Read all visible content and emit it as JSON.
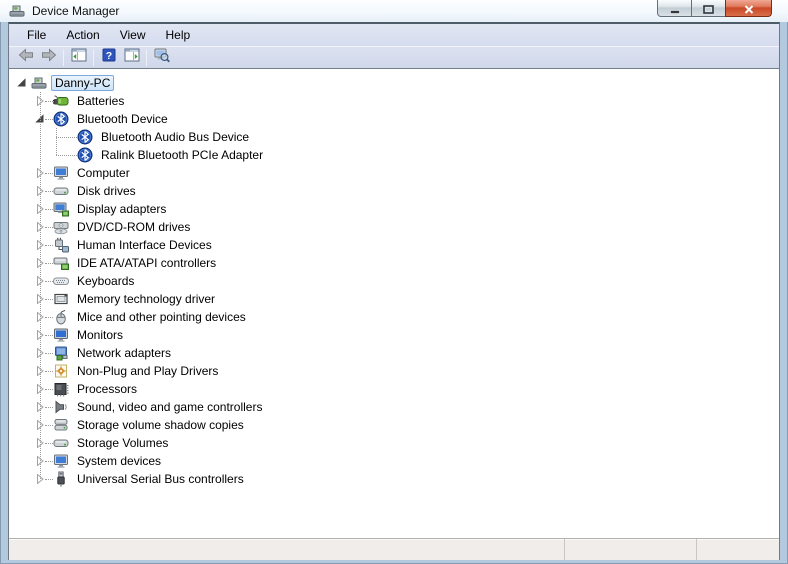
{
  "window": {
    "title": "Device Manager",
    "icon": "device-manager-icon",
    "controls": [
      {
        "name": "minimize"
      },
      {
        "name": "maximize"
      },
      {
        "name": "close"
      }
    ]
  },
  "menubar": {
    "items": [
      {
        "label": "File"
      },
      {
        "label": "Action"
      },
      {
        "label": "View"
      },
      {
        "label": "Help"
      }
    ]
  },
  "toolbar": {
    "buttons": [
      {
        "name": "back",
        "icon": "back-arrow-icon",
        "disabled": true
      },
      {
        "name": "forward",
        "icon": "forward-arrow-icon",
        "disabled": true
      },
      {
        "separator": true
      },
      {
        "name": "show-console-tree",
        "icon": "console-tree-icon"
      },
      {
        "separator": true
      },
      {
        "name": "help",
        "icon": "help-icon"
      },
      {
        "name": "show-action-pane",
        "icon": "action-pane-icon"
      },
      {
        "separator": true
      },
      {
        "name": "scan-for-hardware-changes",
        "icon": "scan-icon"
      }
    ]
  },
  "tree": {
    "items": [
      {
        "label": "Danny-PC",
        "level": 0,
        "expander": "expanded",
        "icon": "computer-root-icon",
        "selected": true
      },
      {
        "label": "Batteries",
        "level": 1,
        "expander": "collapsed",
        "icon": "battery-icon",
        "selected": false
      },
      {
        "label": "Bluetooth Device",
        "level": 1,
        "expander": "expanded",
        "icon": "bluetooth-icon",
        "selected": false
      },
      {
        "label": "Bluetooth Audio Bus Device",
        "level": 2,
        "expander": "none",
        "icon": "bluetooth-icon",
        "selected": false
      },
      {
        "label": "Ralink Bluetooth PCIe Adapter",
        "level": 2,
        "expander": "none",
        "icon": "bluetooth-icon",
        "selected": false
      },
      {
        "label": "Computer",
        "level": 1,
        "expander": "collapsed",
        "icon": "computer-icon",
        "selected": false
      },
      {
        "label": "Disk drives",
        "level": 1,
        "expander": "collapsed",
        "icon": "disk-drive-icon",
        "selected": false
      },
      {
        "label": "Display adapters",
        "level": 1,
        "expander": "collapsed",
        "icon": "display-adapter-icon",
        "selected": false
      },
      {
        "label": "DVD/CD-ROM drives",
        "level": 1,
        "expander": "collapsed",
        "icon": "dvd-drive-icon",
        "selected": false
      },
      {
        "label": "Human Interface Devices",
        "level": 1,
        "expander": "collapsed",
        "icon": "hid-icon",
        "selected": false
      },
      {
        "label": "IDE ATA/ATAPI controllers",
        "level": 1,
        "expander": "collapsed",
        "icon": "ide-controller-icon",
        "selected": false
      },
      {
        "label": "Keyboards",
        "level": 1,
        "expander": "collapsed",
        "icon": "keyboard-icon",
        "selected": false
      },
      {
        "label": "Memory technology driver",
        "level": 1,
        "expander": "collapsed",
        "icon": "memory-card-icon",
        "selected": false
      },
      {
        "label": "Mice and other pointing devices",
        "level": 1,
        "expander": "collapsed",
        "icon": "mouse-icon",
        "selected": false
      },
      {
        "label": "Monitors",
        "level": 1,
        "expander": "collapsed",
        "icon": "monitor-icon",
        "selected": false
      },
      {
        "label": "Network adapters",
        "level": 1,
        "expander": "collapsed",
        "icon": "network-adapter-icon",
        "selected": false
      },
      {
        "label": "Non-Plug and Play Drivers",
        "level": 1,
        "expander": "collapsed",
        "icon": "non-pnp-driver-icon",
        "selected": false
      },
      {
        "label": "Processors",
        "level": 1,
        "expander": "collapsed",
        "icon": "processor-icon",
        "selected": false
      },
      {
        "label": "Sound, video and game controllers",
        "level": 1,
        "expander": "collapsed",
        "icon": "sound-icon",
        "selected": false
      },
      {
        "label": "Storage volume shadow copies",
        "level": 1,
        "expander": "collapsed",
        "icon": "shadow-copy-icon",
        "selected": false
      },
      {
        "label": "Storage Volumes",
        "level": 1,
        "expander": "collapsed",
        "icon": "storage-volume-icon",
        "selected": false
      },
      {
        "label": "System devices",
        "level": 1,
        "expander": "collapsed",
        "icon": "system-devices-icon",
        "selected": false
      },
      {
        "label": "Universal Serial Bus controllers",
        "level": 1,
        "expander": "collapsed",
        "icon": "usb-controller-icon",
        "selected": false
      }
    ]
  },
  "statusbar": {
    "text": ""
  },
  "colors": {
    "selection_fill": "#cde4f9",
    "selection_border": "#7ea8d9",
    "close_button": "#c94926",
    "help_icon_blue": "#2f55bd",
    "chrome_lavender": "#d5dcee",
    "statusbar_bg": "#f0edea"
  }
}
